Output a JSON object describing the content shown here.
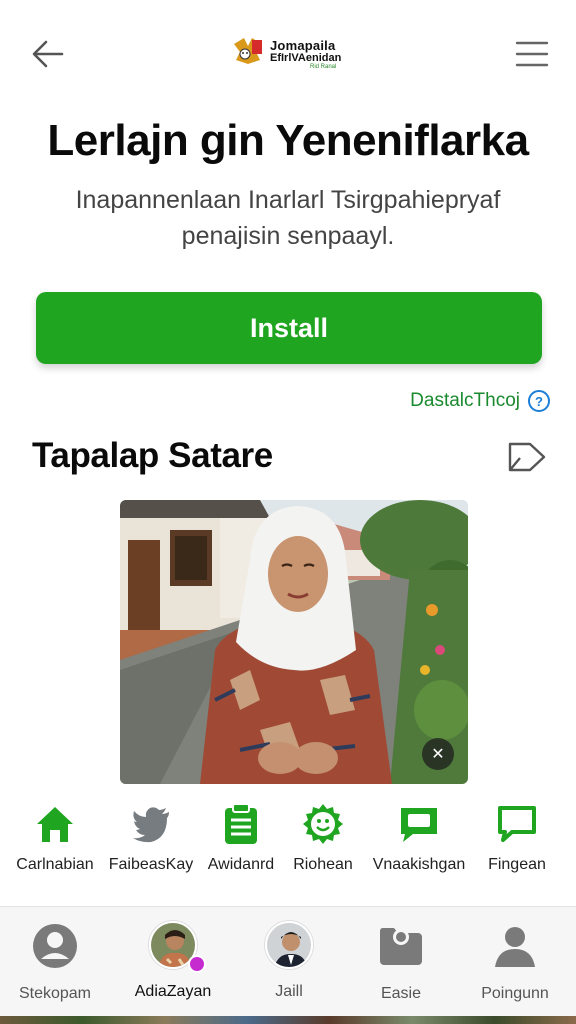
{
  "header": {
    "logo_line1": "Jomapaila",
    "logo_line2": "EfIrlVAenidan",
    "logo_line3": "Rid Ranal"
  },
  "hero": {
    "title": "Lerlajn gin Yeneniflarka",
    "subtitle": "Inapannenlaan Inarlarl Tsirgpahiepryaf penajisin senpaayl."
  },
  "install_button": {
    "label": "Install"
  },
  "details_link": {
    "label": "DastalcThcoj",
    "icon": "info-icon"
  },
  "section": {
    "title": "Tapalap Satare"
  },
  "actions": [
    {
      "label": "Carlnabian",
      "icon": "home-icon"
    },
    {
      "label": "FaibeasKay",
      "icon": "bird-icon"
    },
    {
      "label": "Awidanrd",
      "icon": "clipboard-icon"
    },
    {
      "label": "Riohean",
      "icon": "gear-smile-icon"
    },
    {
      "label": "Vnaakishgan",
      "icon": "chat-icon"
    },
    {
      "label": "Fingean",
      "icon": "chat-outline-icon"
    }
  ],
  "bottom_nav": [
    {
      "label": "Stekopam",
      "icon": "profile-icon"
    },
    {
      "label": "AdiaZayan",
      "icon": "avatar"
    },
    {
      "label": "Jaill",
      "icon": "avatar"
    },
    {
      "label": "Easie",
      "icon": "folder-icon"
    },
    {
      "label": "Poingunn",
      "icon": "person-icon"
    }
  ],
  "colors": {
    "accent": "#1fa51f",
    "link": "#1b8a2e",
    "info": "#1c7ed6"
  }
}
